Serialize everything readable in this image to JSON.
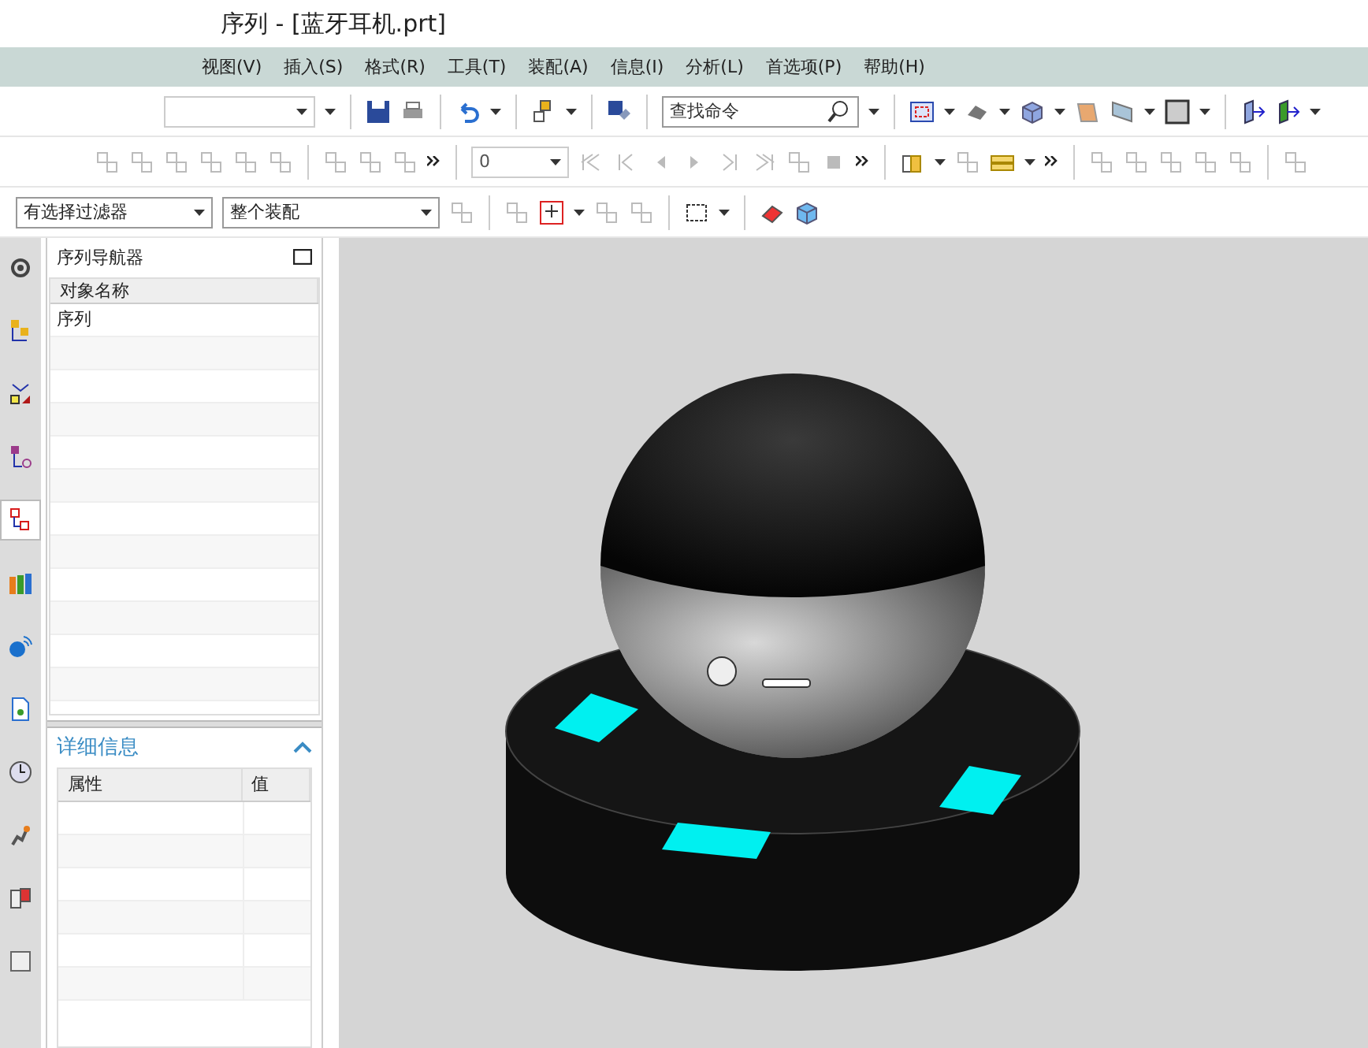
{
  "window": {
    "title": "序列 - [蓝牙耳机.prt]"
  },
  "menu": [
    "视图(V)",
    "插入(S)",
    "格式(R)",
    "工具(T)",
    "装配(A)",
    "信息(I)",
    "分析(L)",
    "首选项(P)",
    "帮助(H)"
  ],
  "toolbar": {
    "search": {
      "placeholder": "查找命令"
    },
    "frame_field": {
      "value": "0"
    },
    "filter": {
      "value": "有选择过滤器"
    },
    "scope": {
      "value": "整个装配"
    }
  },
  "side_tabs": [
    {
      "selected": false
    },
    {
      "selected": false
    },
    {
      "selected": false
    },
    {
      "selected": false
    },
    {
      "selected": true
    },
    {
      "selected": false
    },
    {
      "selected": false
    },
    {
      "selected": false
    },
    {
      "selected": false
    },
    {
      "selected": false
    },
    {
      "selected": false
    },
    {
      "selected": false
    }
  ],
  "navigator": {
    "title": "序列导航器",
    "columns": [
      "对象名称"
    ],
    "rows": [
      "序列"
    ]
  },
  "details": {
    "title": "详细信息",
    "expanded": true,
    "columns": [
      "属性",
      "值"
    ]
  }
}
